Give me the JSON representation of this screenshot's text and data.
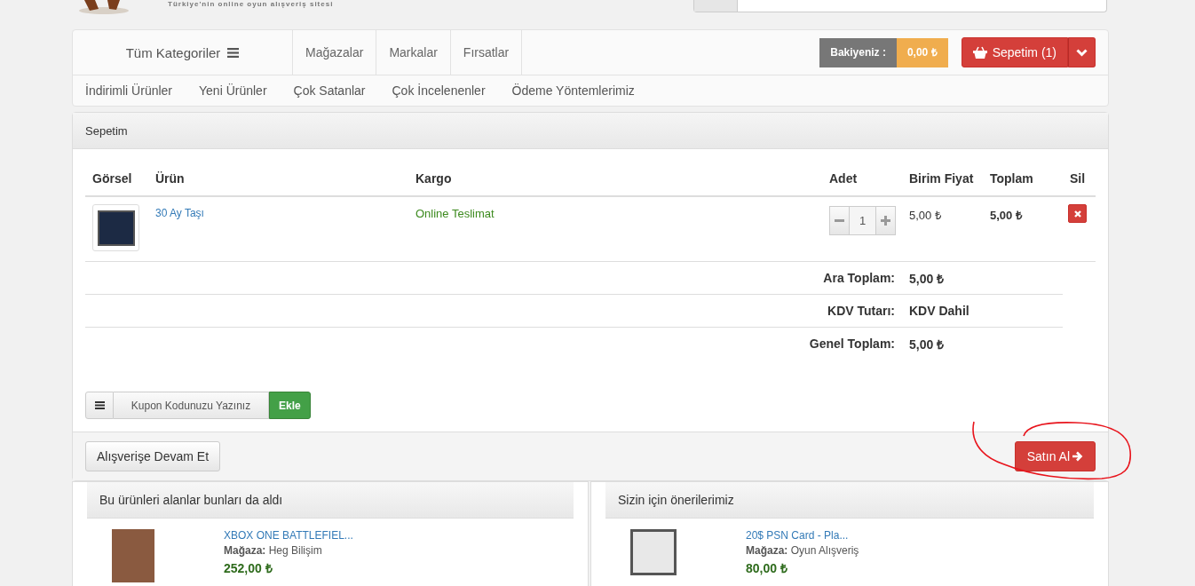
{
  "header": {
    "tagline": "Türkiye'nin online oyun alışveriş sitesi"
  },
  "nav": {
    "categories_label": "Tüm Kategoriler",
    "links": [
      "Mağazalar",
      "Markalar",
      "Fırsatlar"
    ],
    "balance_label": "Bakiyeniz :",
    "balance_value": "0,00 ₺",
    "cart_button": "Sepetim (1)"
  },
  "subnav": [
    "İndirimli Ürünler",
    "Yeni Ürünler",
    "Çok Satanlar",
    "Çok İncelenenler",
    "Ödeme Yöntemlerimiz"
  ],
  "cart": {
    "title": "Sepetim",
    "columns": [
      "Görsel",
      "Ürün",
      "Kargo",
      "Adet",
      "Birim Fiyat",
      "Toplam",
      "Sil"
    ],
    "items": [
      {
        "name": "30 Ay Taşı",
        "shipping": "Online Teslimat",
        "quantity": "1",
        "unit_price": "5,00 ₺",
        "total": "5,00 ₺"
      }
    ],
    "summary": [
      {
        "label": "Ara Toplam:",
        "value": "5,00 ₺"
      },
      {
        "label": "KDV Tutarı:",
        "value": "KDV Dahil"
      },
      {
        "label": "Genel Toplam:",
        "value": "5,00 ₺"
      }
    ],
    "coupon": {
      "placeholder": "Kupon Kodunuzu Yazınız",
      "button": "Ekle"
    },
    "continue_button": "Alışverişe Devam Et",
    "buy_button": "Satın Al"
  },
  "panels": [
    {
      "title": "Bu ürünleri alanlar bunları da aldı",
      "products": [
        {
          "name": "XBOX ONE BATTLEFIEL...",
          "store_label": "Mağaza:",
          "store": "Heg Bilişim",
          "price": "252,00 ₺"
        }
      ]
    },
    {
      "title": "Sizin için önerilerimiz",
      "products": [
        {
          "name": "20$ PSN Card - Pla...",
          "store_label": "Mağaza:",
          "store": "Oyun Alışveriş",
          "price": "80,00 ₺"
        }
      ]
    }
  ]
}
